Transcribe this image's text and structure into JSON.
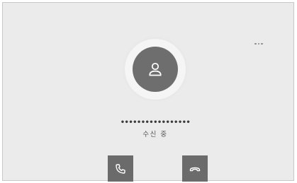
{
  "call": {
    "phone_number": "•••••••••••••••••",
    "status": "수신 중"
  },
  "icons": {
    "more": "more-horizontal-icon",
    "avatar": "person-icon",
    "answer": "phone-answer-icon",
    "decline": "phone-hangup-icon"
  },
  "colors": {
    "background": "#ebebeb",
    "button": "#6b6b6b",
    "avatar": "#6e6e6e",
    "icon": "#ffffff"
  }
}
